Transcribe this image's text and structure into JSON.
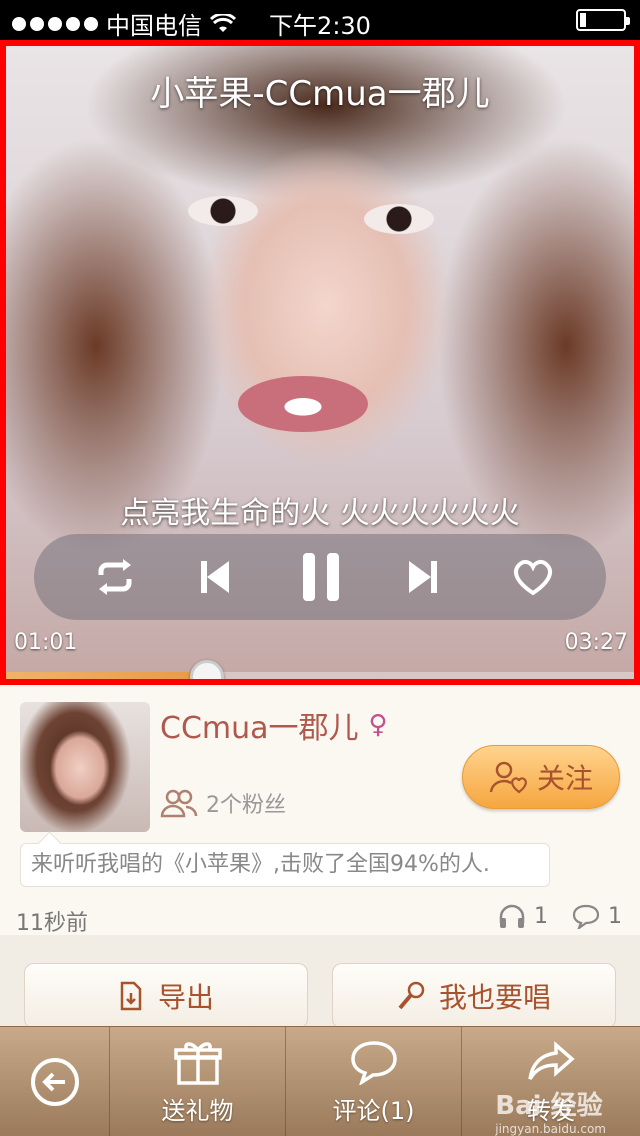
{
  "status_bar": {
    "carrier": "中国电信",
    "time": "下午2:30"
  },
  "player": {
    "title": "小苹果-CCmua一郡儿",
    "lyric": "点亮我生命的火 火火火火火火",
    "current_time": "01:01",
    "total_time": "03:27",
    "progress": 0.32
  },
  "user": {
    "name": "CCmua一郡儿",
    "gender_symbol": "♀",
    "fans": "2个粉丝",
    "follow_label": "关注",
    "message": "来听听我唱的《小苹果》,击败了全国94%的人.",
    "posted": "11秒前",
    "listens": "1",
    "comments": "1"
  },
  "actions": {
    "export_label": "导出",
    "sing_label": "我也要唱"
  },
  "tabbar": {
    "gift_label": "送礼物",
    "comment_label": "评论(1)",
    "share_label": "转发"
  },
  "watermark": {
    "brand": "Bai 经验",
    "url": "jingyan.baidu.com"
  },
  "colors": {
    "accent": "#b0584c",
    "highlight": "#ff0000",
    "follow": "#f6a640"
  }
}
